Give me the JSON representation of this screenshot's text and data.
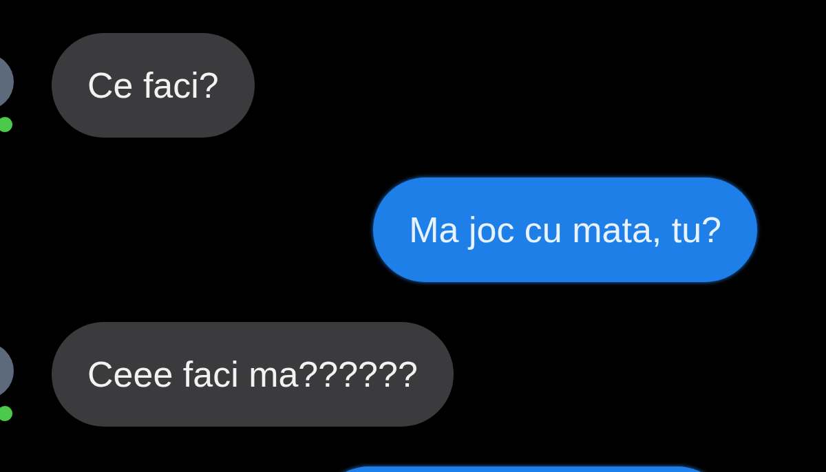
{
  "messages": [
    {
      "kind": "incoming",
      "text": "Ce faci?",
      "online": true
    },
    {
      "kind": "outgoing",
      "text": "Ma joc cu mata, tu?"
    },
    {
      "kind": "incoming",
      "text": "Ceee faci ma??????",
      "online": true
    },
    {
      "kind": "outgoing"
    }
  ]
}
